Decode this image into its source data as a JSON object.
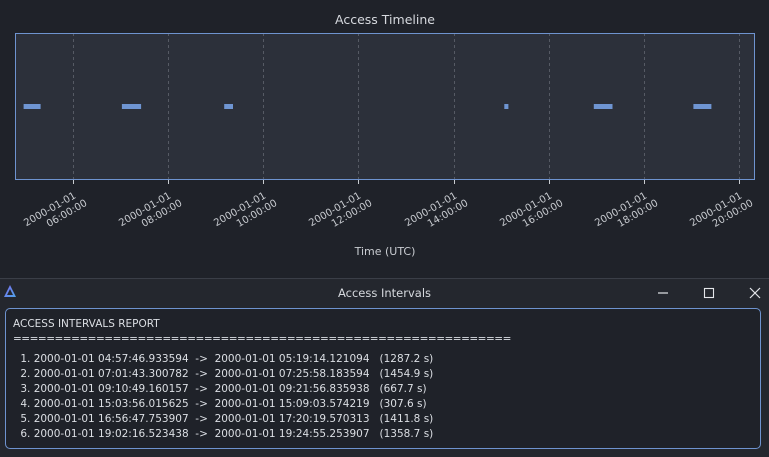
{
  "chart_data": {
    "type": "timeline",
    "title": "Access Timeline",
    "xlabel": "Time (UTC)",
    "ylabel": "",
    "xlim": [
      "2000-01-01 04:47:00",
      "2000-01-01 20:20:00"
    ],
    "ticks": [
      {
        "time": "2000-01-01 06:00:00",
        "line1": "2000-01-01",
        "line2": "06:00:00"
      },
      {
        "time": "2000-01-01 08:00:00",
        "line1": "2000-01-01",
        "line2": "08:00:00"
      },
      {
        "time": "2000-01-01 10:00:00",
        "line1": "2000-01-01",
        "line2": "10:00:00"
      },
      {
        "time": "2000-01-01 12:00:00",
        "line1": "2000-01-01",
        "line2": "12:00:00"
      },
      {
        "time": "2000-01-01 14:00:00",
        "line1": "2000-01-01",
        "line2": "14:00:00"
      },
      {
        "time": "2000-01-01 16:00:00",
        "line1": "2000-01-01",
        "line2": "16:00:00"
      },
      {
        "time": "2000-01-01 18:00:00",
        "line1": "2000-01-01",
        "line2": "18:00:00"
      },
      {
        "time": "2000-01-01 20:00:00",
        "line1": "2000-01-01",
        "line2": "20:00:00"
      }
    ],
    "intervals": [
      {
        "start": "2000-01-01 04:57:46.933594",
        "end": "2000-01-01 05:19:14.121094"
      },
      {
        "start": "2000-01-01 07:01:43.300782",
        "end": "2000-01-01 07:25:58.183594"
      },
      {
        "start": "2000-01-01 09:10:49.160157",
        "end": "2000-01-01 09:21:56.835938"
      },
      {
        "start": "2000-01-01 15:03:56.015625",
        "end": "2000-01-01 15:09:03.574219"
      },
      {
        "start": "2000-01-01 16:56:47.753907",
        "end": "2000-01-01 17:20:19.570313"
      },
      {
        "start": "2000-01-01 19:02:16.523438",
        "end": "2000-01-01 19:24:55.253907"
      }
    ],
    "grid": true,
    "colors": {
      "bar": "#6f95d2",
      "plot_bg": "#2c303a",
      "plot_border": "#6e93cf",
      "grid": "#62666f"
    }
  },
  "window": {
    "title": "Access Intervals",
    "logo_icon": "app-logo-icon",
    "minimize_icon": "minimize-icon",
    "maximize_icon": "maximize-icon",
    "close_icon": "close-icon"
  },
  "report": {
    "heading": "ACCESS INTERVALS REPORT",
    "rule": "============================================================",
    "rows": [
      " 1. 2000-01-01 04:57:46.933594  ->  2000-01-01 05:19:14.121094   (1287.2 s)",
      " 2. 2000-01-01 07:01:43.300782  ->  2000-01-01 07:25:58.183594   (1454.9 s)",
      " 3. 2000-01-01 09:10:49.160157  ->  2000-01-01 09:21:56.835938   (667.7 s)",
      " 4. 2000-01-01 15:03:56.015625  ->  2000-01-01 15:09:03.574219   (307.6 s)",
      " 5. 2000-01-01 16:56:47.753907  ->  2000-01-01 17:20:19.570313   (1411.8 s)",
      " 6. 2000-01-01 19:02:16.523438  ->  2000-01-01 19:24:55.253907   (1358.7 s)"
    ]
  }
}
